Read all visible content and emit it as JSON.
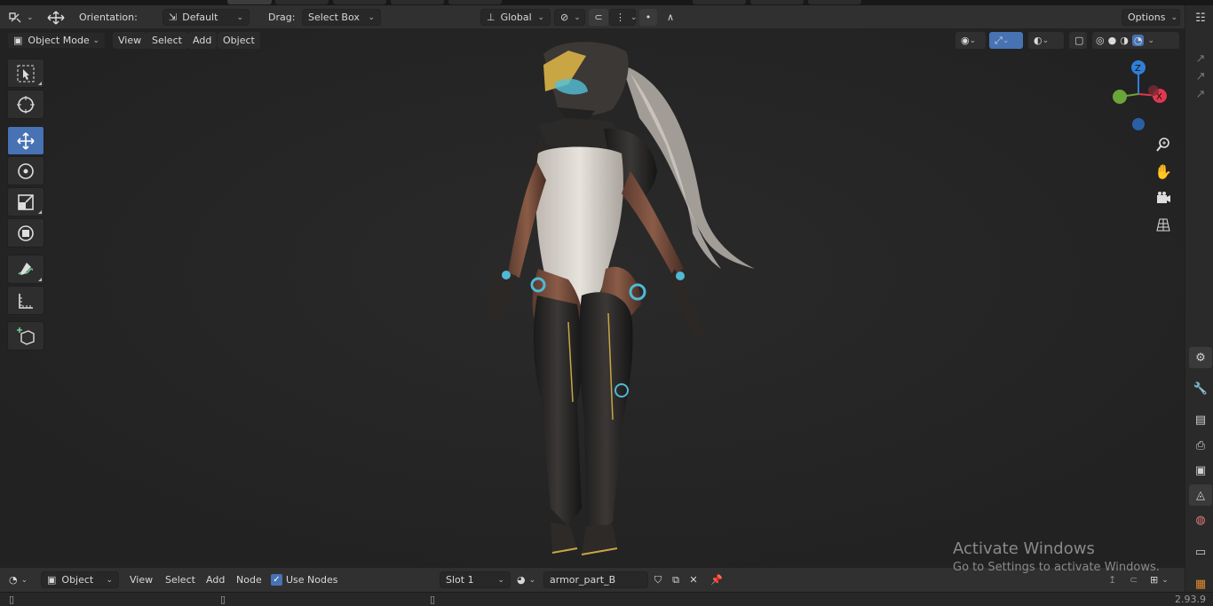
{
  "header": {
    "orientation_label": "Orientation:",
    "orientation_value": "Default",
    "drag_label": "Drag:",
    "drag_value": "Select Box",
    "transform_space": "Global",
    "options_label": "Options"
  },
  "viewport_header": {
    "mode": "Object Mode",
    "menus": [
      "View",
      "Select",
      "Add",
      "Object"
    ]
  },
  "gizmo": {
    "z_label": "Z",
    "x_label": "X"
  },
  "toolbar": {
    "tools": [
      "select-box",
      "cursor",
      "move",
      "rotate",
      "scale",
      "transform",
      "annotate",
      "measure",
      "add-cube"
    ],
    "active": "move"
  },
  "node_header": {
    "editor_type": "Object",
    "menus": [
      "View",
      "Select",
      "Add",
      "Node"
    ],
    "use_nodes_label": "Use Nodes",
    "use_nodes_checked": true,
    "slot": "Slot 1",
    "material_name": "armor_part_B"
  },
  "status": {
    "version": "2.93.9"
  },
  "watermark": {
    "title": "Activate Windows",
    "subtitle": "Go to Settings to activate Windows."
  },
  "colors": {
    "accent": "#4772b3",
    "axis_z": "#2f7fd8",
    "axis_x": "#e0384f",
    "axis_y": "#6aa53a"
  }
}
